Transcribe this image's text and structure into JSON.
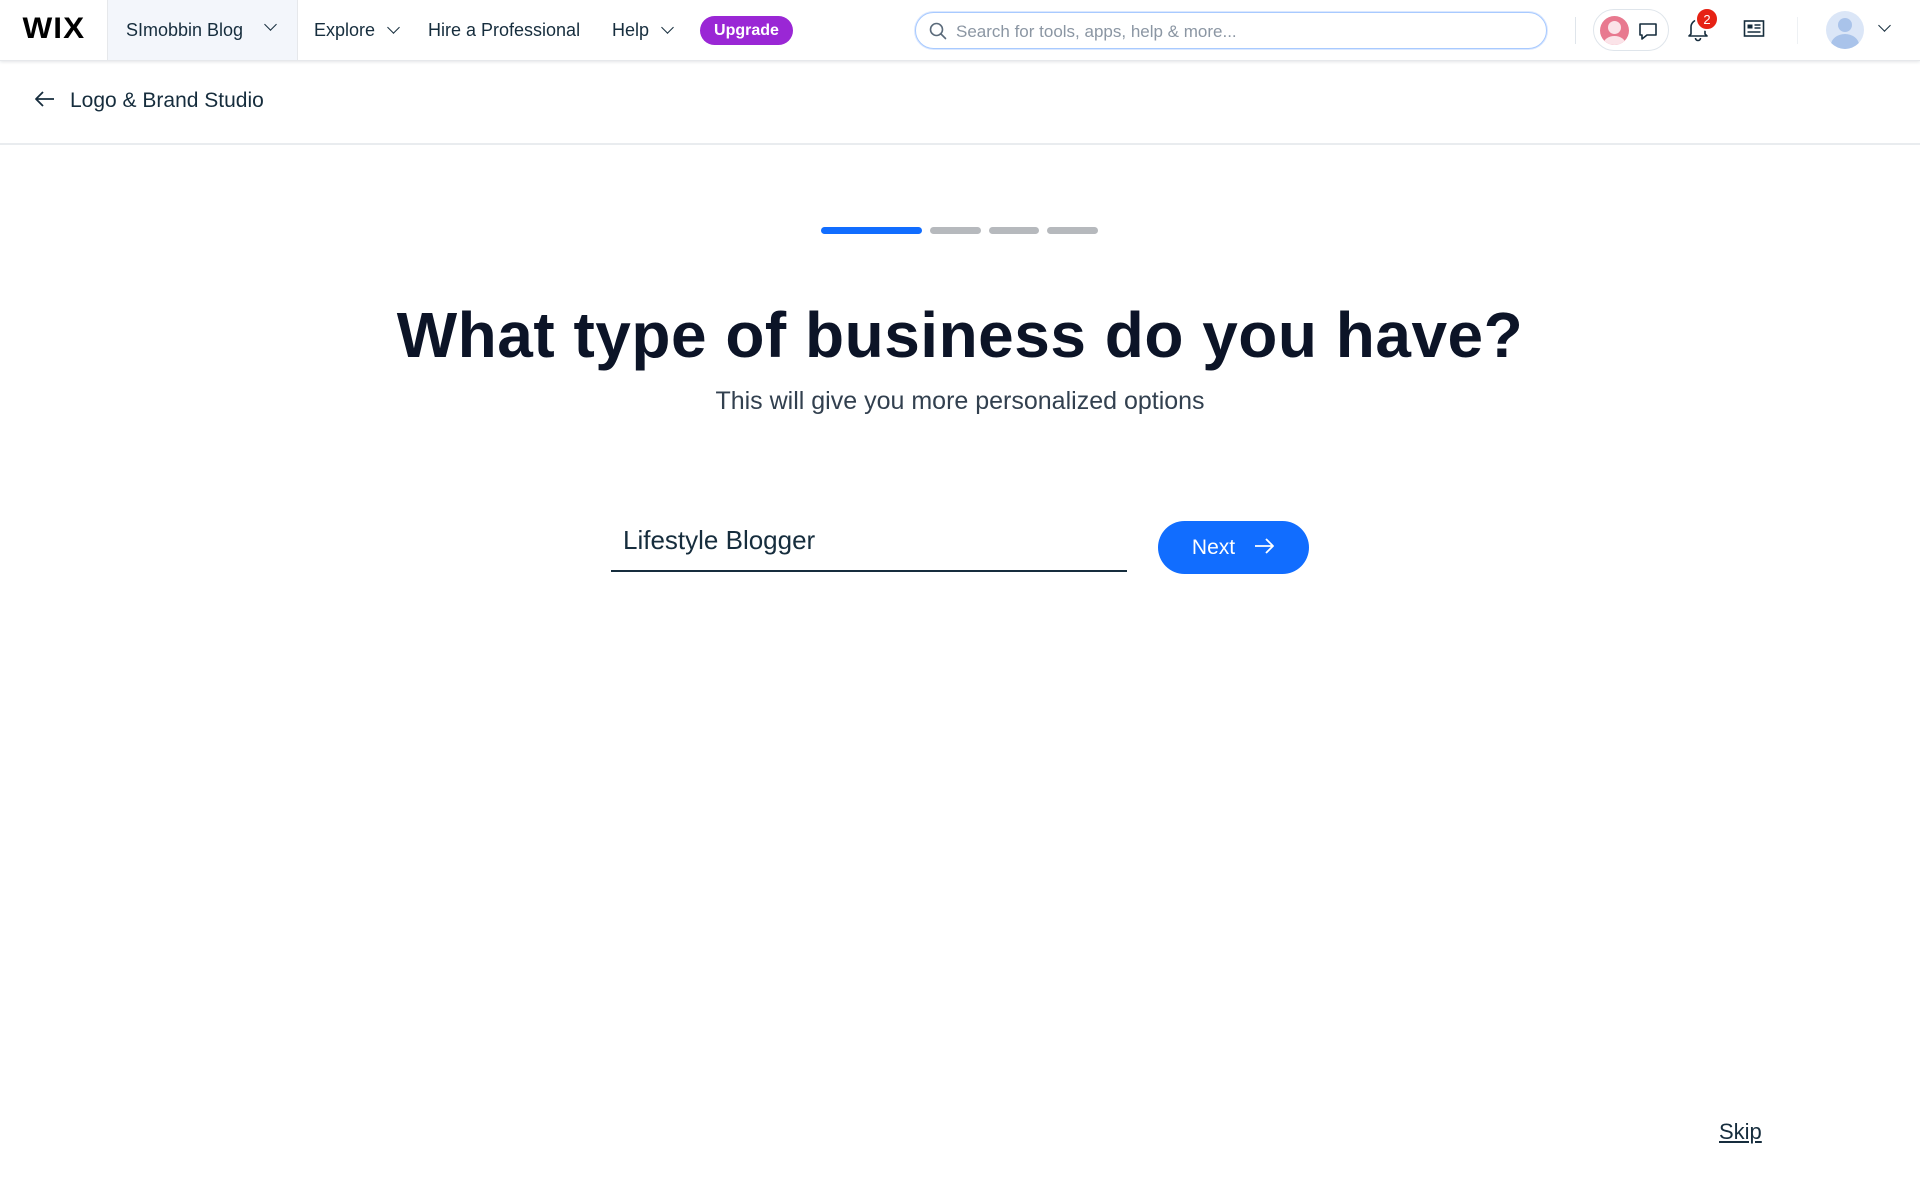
{
  "topbar": {
    "logo": "WIX",
    "site_name": "SImobbin Blog",
    "nav": [
      {
        "label": "Explore"
      },
      {
        "label": "Hire a Professional"
      },
      {
        "label": "Help"
      }
    ],
    "upgrade_label": "Upgrade",
    "search_placeholder": "Search for tools, apps, help & more...",
    "notification_count": "2",
    "colors": {
      "upgrade": "#9a27d5",
      "badge": "#e62214",
      "accent": "#116dff"
    }
  },
  "subheader": {
    "back_title": "Logo & Brand Studio"
  },
  "wizard": {
    "progress": {
      "total_steps": 4,
      "current_step": 1
    },
    "heading": "What type of business do you have?",
    "subheading": "This will give you more personalized options",
    "answer_value": "Lifestyle Blogger",
    "next_label": "Next",
    "skip_label": "Skip"
  },
  "icons": [
    "search-icon",
    "chat-icon",
    "bell-icon",
    "newsfeed-icon",
    "arrow-left-icon",
    "arrow-right-icon",
    "chevron-down-icon"
  ]
}
